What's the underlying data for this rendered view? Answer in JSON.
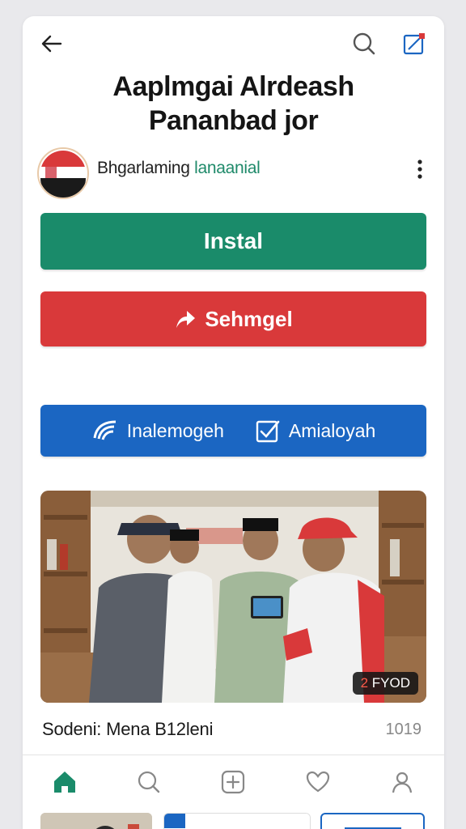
{
  "header": {
    "back_icon": "arrow-left-icon",
    "search_icon": "search-icon",
    "share_icon": "share-icon"
  },
  "app": {
    "title_line1": "Aaplmgai Alrdeash",
    "title_line2": "Pananbad jor",
    "developer_name": "Bhgarlaming",
    "developer_tag": "lanaanial"
  },
  "buttons": {
    "install_label": "Instal",
    "share_label": "Sehmgel",
    "blue_left_label": "Inalemogeh",
    "blue_right_label": "Amialoyah"
  },
  "media": {
    "badge_number": "2",
    "badge_text": "FYOD",
    "caption": "Sodeni: Mena B12leni",
    "count": "1019"
  },
  "bottom_nav": {
    "items": [
      "home-icon",
      "search-icon",
      "add-icon",
      "heart-icon",
      "profile-icon"
    ]
  },
  "colors": {
    "install": "#1a8b6a",
    "share": "#d9393a",
    "blue": "#1b66c2",
    "developer_tag": "#1f8a6a"
  }
}
